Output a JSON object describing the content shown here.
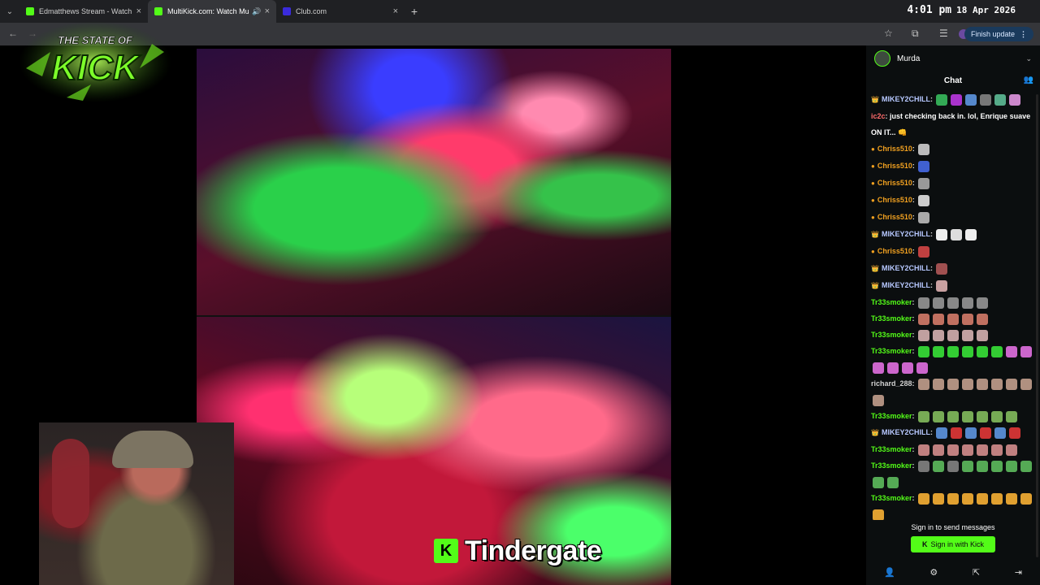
{
  "browser": {
    "tabs": [
      {
        "title": "Edmatthews Stream - Watch Live",
        "favicon": "kick-favicon",
        "favicon_color": "#53fc18",
        "active": false
      },
      {
        "title": "MultiKick.com: Watch Multiple",
        "favicon": "multikick-favicon",
        "favicon_color": "#53fc18",
        "active": true
      },
      {
        "title": "Club.com",
        "favicon": "club-favicon",
        "favicon_color": "#3a2bdc",
        "active": false
      }
    ],
    "tab_close_symbol": "×",
    "new_tab_symbol": "+",
    "clock_time": "4:01 pm",
    "clock_date": "18 Apr 2026",
    "finish_update_label": "Finish update",
    "finish_update_more": "⋮"
  },
  "overlay": {
    "logo_top": "THE STATE OF",
    "logo_main": "KICK",
    "logo_color": "#53fc18"
  },
  "caption": {
    "badge": "K",
    "text": "Tindergate"
  },
  "chat": {
    "channel_name": "Murda",
    "title": "Chat",
    "messages": [
      {
        "badge": "👑",
        "user": "MIKEY2CHILL",
        "color": "#b7c8ff",
        "text": "",
        "emotes": [
          "#3a5",
          "#a3c",
          "#58c",
          "#777",
          "#5a8",
          "#c8c"
        ]
      },
      {
        "badge": "",
        "user": "ic2c",
        "color": "#ff6b6b",
        "text": "just checking back in. lol, Enrique suave ON IT... 👊",
        "emotes": []
      },
      {
        "badge": "●",
        "user": "Chriss510",
        "color": "#f0a020",
        "text": "",
        "emotes": [
          "#bbb"
        ]
      },
      {
        "badge": "●",
        "user": "Chriss510",
        "color": "#f0a020",
        "text": "",
        "emotes": [
          "#4060d0"
        ]
      },
      {
        "badge": "●",
        "user": "Chriss510",
        "color": "#f0a020",
        "text": "",
        "emotes": [
          "#999"
        ]
      },
      {
        "badge": "●",
        "user": "Chriss510",
        "color": "#f0a020",
        "text": "",
        "emotes": [
          "#ccc"
        ]
      },
      {
        "badge": "●",
        "user": "Chriss510",
        "color": "#f0a020",
        "text": "",
        "emotes": [
          "#aaa"
        ]
      },
      {
        "badge": "👑",
        "user": "MIKEY2CHILL",
        "color": "#b7c8ff",
        "text": "",
        "emotes": [
          "#eee",
          "#ddd",
          "#eee"
        ]
      },
      {
        "badge": "●",
        "user": "Chriss510",
        "color": "#f0a020",
        "text": "",
        "emotes": [
          "#c04040"
        ]
      },
      {
        "badge": "👑",
        "user": "MIKEY2CHILL",
        "color": "#b7c8ff",
        "text": "",
        "emotes": [
          "#a05050"
        ]
      },
      {
        "badge": "👑",
        "user": "MIKEY2CHILL",
        "color": "#b7c8ff",
        "text": "",
        "emotes": [
          "#c8a0a0"
        ]
      },
      {
        "badge": "",
        "user": "Tr33smoker",
        "color": "#53fc18",
        "text": "",
        "emotes": [
          "#888",
          "#888",
          "#888",
          "#888",
          "#888"
        ]
      },
      {
        "badge": "",
        "user": "Tr33smoker",
        "color": "#53fc18",
        "text": "",
        "emotes": [
          "#c07060",
          "#c07060",
          "#c07060",
          "#c07060",
          "#c07060"
        ]
      },
      {
        "badge": "",
        "user": "Tr33smoker",
        "color": "#53fc18",
        "text": "",
        "emotes": [
          "#c0a0a0",
          "#c0a0a0",
          "#c0a0a0",
          "#c0a0a0",
          "#c0a0a0"
        ]
      },
      {
        "badge": "",
        "user": "Tr33smoker",
        "color": "#53fc18",
        "text": "",
        "emotes": [
          "#3c3",
          "#3c3",
          "#3c3",
          "#3c3",
          "#3c3",
          "#3c3",
          "#c6c",
          "#c6c",
          "#c6c",
          "#c6c",
          "#c6c",
          "#c6c"
        ]
      },
      {
        "badge": "",
        "user": "richard_288",
        "color": "#d0d0d0",
        "text": "",
        "emotes": [
          "#b09080",
          "#b09080",
          "#b09080",
          "#b09080",
          "#b09080",
          "#b09080",
          "#b09080",
          "#b09080",
          "#b09080"
        ]
      },
      {
        "badge": "",
        "user": "Tr33smoker",
        "color": "#53fc18",
        "text": "",
        "emotes": [
          "#7a5",
          "#7a5",
          "#7a5",
          "#7a5",
          "#7a5",
          "#7a5",
          "#7a5"
        ]
      },
      {
        "badge": "👑",
        "user": "MIKEY2CHILL",
        "color": "#b7c8ff",
        "text": "",
        "emotes": [
          "#58c",
          "#c33",
          "#58c",
          "#c33",
          "#58c",
          "#c33"
        ]
      },
      {
        "badge": "",
        "user": "Tr33smoker",
        "color": "#53fc18",
        "text": "",
        "emotes": [
          "#c08080",
          "#c08080",
          "#c08080",
          "#c08080",
          "#c08080",
          "#c08080",
          "#c08080"
        ]
      },
      {
        "badge": "",
        "user": "Tr33smoker",
        "color": "#53fc18",
        "text": "",
        "emotes": [
          "#777",
          "#5a5",
          "#777",
          "#5a5",
          "#5a5",
          "#5a5",
          "#5a5",
          "#5a5",
          "#5a5",
          "#5a5"
        ]
      },
      {
        "badge": "",
        "user": "Tr33smoker",
        "color": "#53fc18",
        "text": "",
        "emotes": [
          "#e0a030",
          "#e0a030",
          "#e0a030",
          "#e0a030",
          "#e0a030",
          "#e0a030",
          "#e0a030",
          "#e0a030",
          "#e0a030"
        ]
      }
    ],
    "signin_prompt": "Sign in to send messages",
    "signin_button": "Sign in with Kick",
    "signin_button_icon": "K"
  }
}
